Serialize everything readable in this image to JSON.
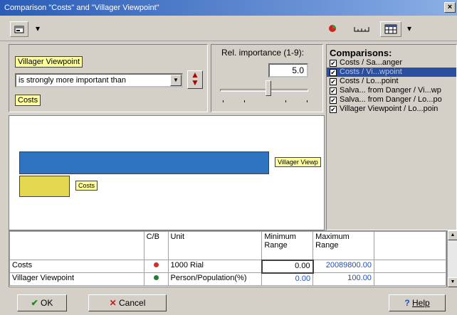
{
  "window": {
    "title": "Comparison \"Costs\" and \"Villager Viewpoint\"",
    "close": "×"
  },
  "toolbar": {
    "props_icon": "properties-icon",
    "dropdown": "▾"
  },
  "pair": {
    "item_a": "Villager Viewpoint",
    "relation": "is strongly more important than",
    "item_b": "Costs"
  },
  "importance": {
    "label": "Rel. importance (1-9):",
    "value": "5.0",
    "slider_fraction": 0.55
  },
  "comparisons": {
    "title": "Comparisons:",
    "items": [
      {
        "label": "Costs / Sa...anger",
        "checked": true,
        "selected": false
      },
      {
        "label": "Costs / Vi...wpoint",
        "checked": true,
        "selected": true
      },
      {
        "label": "Costs / Lo...point",
        "checked": true,
        "selected": false
      },
      {
        "label": "Salva... from Danger / Vi...wp",
        "checked": true,
        "selected": false
      },
      {
        "label": "Salva... from Danger / Lo...po",
        "checked": true,
        "selected": false
      },
      {
        "label": "Villager Viewpoint / Lo...poin",
        "checked": true,
        "selected": false
      }
    ]
  },
  "graph": {
    "bars": [
      {
        "label": "Villager Viewp",
        "fraction": 0.79,
        "color": "#2e74c0"
      },
      {
        "label": "Costs",
        "fraction": 0.16,
        "color": "#e4d850"
      }
    ]
  },
  "table": {
    "headers": {
      "name": "",
      "cb": "C/B",
      "unit": "Unit",
      "min": "Minimum Range",
      "max": "Maximum Range"
    },
    "rows": [
      {
        "name": "Costs",
        "cb_color": "#d03030",
        "unit": "1000 Rial",
        "min": "0.00",
        "max": "20089800.00"
      },
      {
        "name": "Villager Viewpoint",
        "cb_color": "#208030",
        "unit": "Person/Population(%)",
        "min": "0.00",
        "max": "100.00"
      }
    ]
  },
  "buttons": {
    "ok": "OK",
    "cancel": "Cancel",
    "help": "Help"
  },
  "colors": {
    "titlebar": "#2a5db8",
    "selection": "#2a4ea0",
    "bar_primary": "#2e74c0",
    "bar_secondary": "#e4d850"
  }
}
